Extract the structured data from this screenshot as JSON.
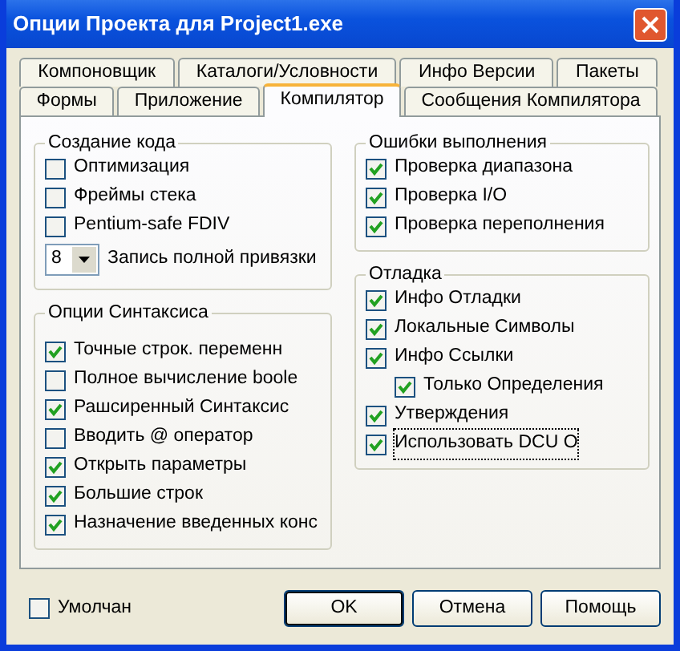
{
  "window": {
    "title": "Опции Проекта для Project1.exe"
  },
  "tab_rows": [
    {
      "tabs": [
        {
          "label": "Компоновщик",
          "selected": false
        },
        {
          "label": "Каталоги/Условности",
          "selected": false
        },
        {
          "label": "Инфо Версии",
          "selected": false
        },
        {
          "label": "Пакеты",
          "selected": false
        }
      ]
    },
    {
      "tabs": [
        {
          "label": "Формы",
          "selected": false
        },
        {
          "label": "Приложение",
          "selected": false
        },
        {
          "label": "Компилятор",
          "selected": true
        },
        {
          "label": "Сообщения Компилятора",
          "selected": false
        }
      ]
    }
  ],
  "left_groups": [
    {
      "title": "Создание кода",
      "items": [
        {
          "kind": "checkbox",
          "label": "Оптимизация",
          "checked": false
        },
        {
          "kind": "checkbox",
          "label": "Фреймы стека",
          "checked": false
        },
        {
          "kind": "checkbox",
          "label": "Pentium-safe FDIV",
          "checked": false
        },
        {
          "kind": "dropdown",
          "value": "8",
          "label": "Запись полной привязки"
        }
      ]
    },
    {
      "title": "Опции Синтаксиса",
      "items": [
        {
          "kind": "checkbox",
          "label": "Точные строк. переменн",
          "checked": true
        },
        {
          "kind": "checkbox",
          "label": "Полное вычисление boole",
          "checked": false
        },
        {
          "kind": "checkbox",
          "label": "Рашсиренный Синтаксис",
          "checked": true
        },
        {
          "kind": "checkbox",
          "label": "Вводить @ оператор",
          "checked": false
        },
        {
          "kind": "checkbox",
          "label": "Открыть параметры",
          "checked": true
        },
        {
          "kind": "checkbox",
          "label": "Большие строк",
          "checked": true
        },
        {
          "kind": "checkbox",
          "label": "Назначение введенных конс",
          "checked": true
        }
      ]
    }
  ],
  "right_groups": [
    {
      "title": "Ошибки выполнения",
      "items": [
        {
          "kind": "checkbox",
          "label": "Проверка диапазона",
          "checked": true
        },
        {
          "kind": "checkbox",
          "label": "Проверка I/O",
          "checked": true
        },
        {
          "kind": "checkbox",
          "label": "Проверка переполнения",
          "checked": true
        }
      ]
    },
    {
      "title": "Отладка",
      "items": [
        {
          "kind": "checkbox",
          "label": "Инфо Отладки",
          "checked": true,
          "focused": false
        },
        {
          "kind": "checkbox",
          "label": "Локальные Символы",
          "checked": true,
          "focused": false
        },
        {
          "kind": "checkbox",
          "label": "Инфо Ссылки",
          "checked": true,
          "focused": false,
          "children": [
            {
              "kind": "checkbox",
              "label": "Только Определения",
              "checked": true,
              "focused": false
            }
          ]
        },
        {
          "kind": "checkbox",
          "label": "Утверждения",
          "checked": true,
          "focused": false
        },
        {
          "kind": "checkbox",
          "label": "Использовать DCU О",
          "checked": true,
          "focused": true
        }
      ]
    }
  ],
  "default_checkbox": {
    "label": "Умолчан",
    "checked": false
  },
  "buttons": [
    {
      "label": "OK",
      "default": true
    },
    {
      "label": "Отмена",
      "default": false
    },
    {
      "label": "Помощь",
      "default": false
    }
  ]
}
